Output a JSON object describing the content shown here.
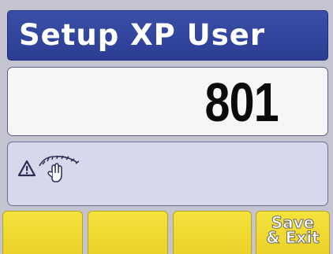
{
  "header": {
    "title": "Setup XP User"
  },
  "value_display": {
    "value": "801"
  },
  "status": {
    "icons": [
      "warning-icon",
      "hand-gesture-icon"
    ]
  },
  "softkeys": [
    {
      "label_line1": "",
      "label_line2": ""
    },
    {
      "label_line1": "",
      "label_line2": ""
    },
    {
      "label_line1": "",
      "label_line2": ""
    },
    {
      "label_line1": "Save",
      "label_line2": "& Exit"
    }
  ],
  "colors": {
    "title_bar": "#2c3d93",
    "value_panel": "#f6f6f8",
    "status_panel": "#d8d8ed",
    "softkey": "#f4e23c",
    "background": "#c4c4d0"
  }
}
